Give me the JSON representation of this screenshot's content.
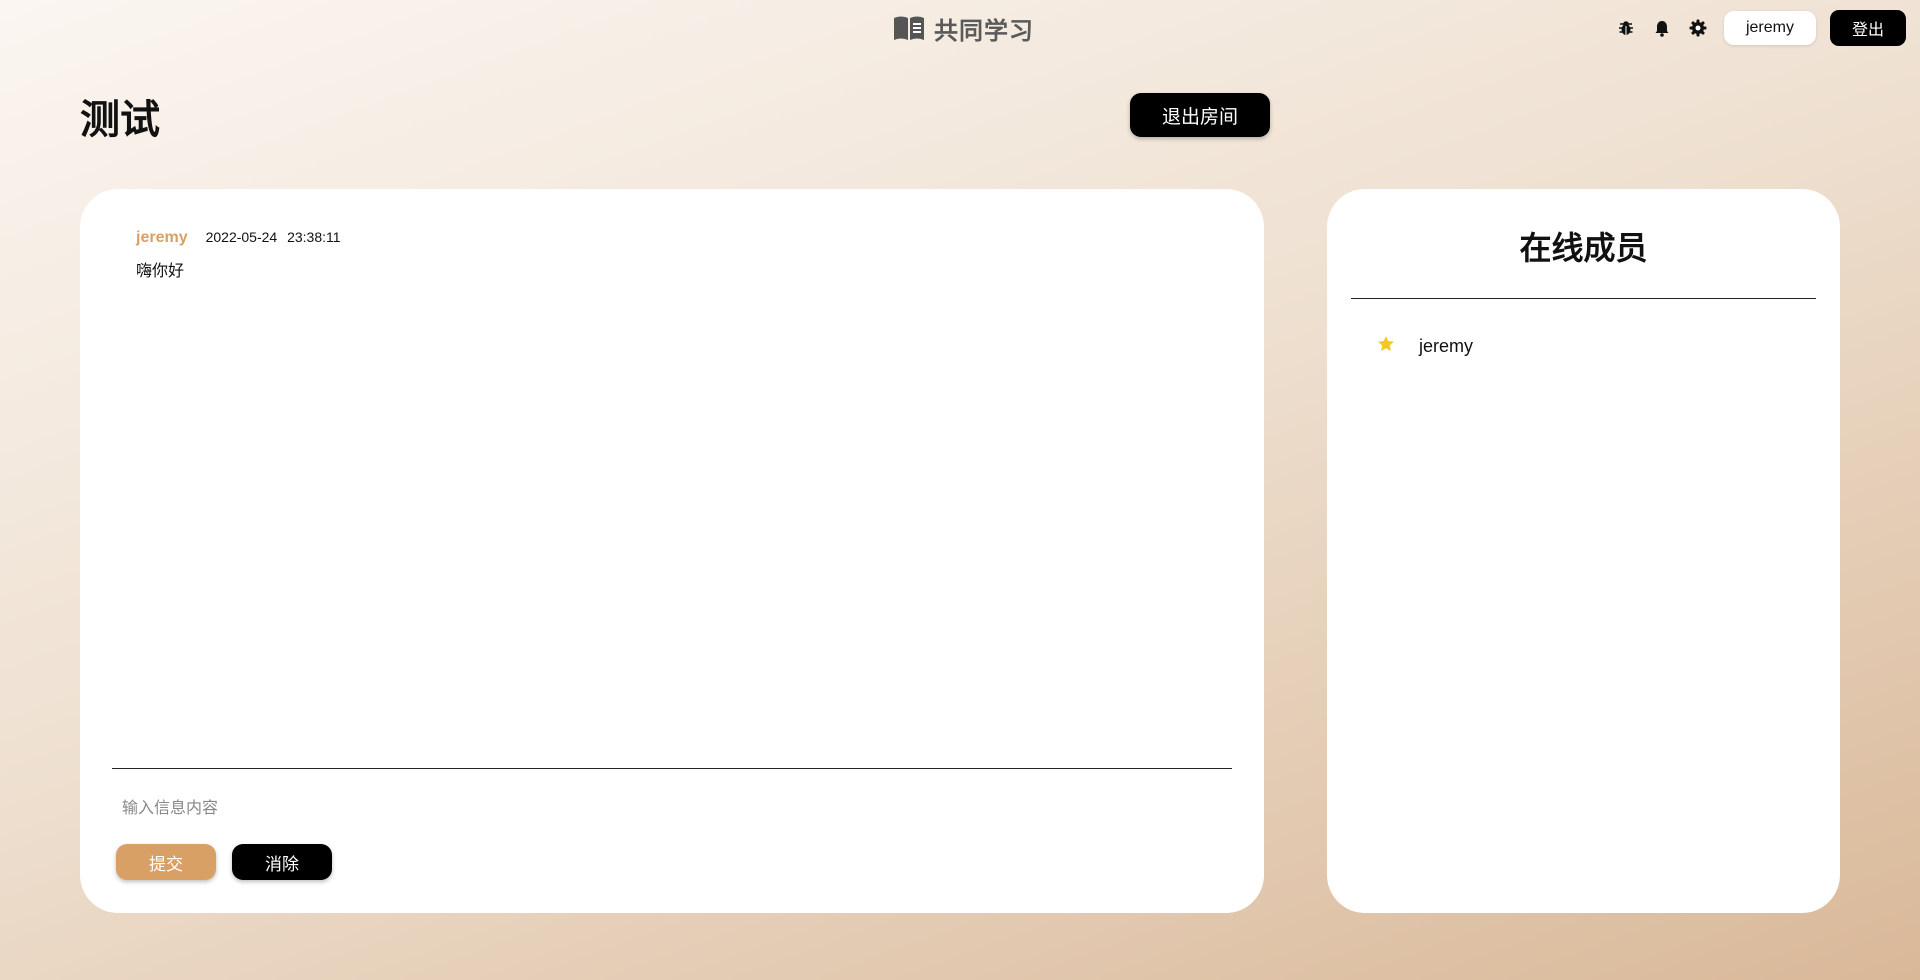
{
  "header": {
    "app_title": "共同学习",
    "app_icon": "book-icon",
    "icons": [
      "bug-icon",
      "bell-icon",
      "gear-icon"
    ],
    "user_name": "jeremy",
    "logout_label": "登出"
  },
  "room": {
    "title": "测试",
    "leave_label": "退出房间"
  },
  "chat": {
    "messages": [
      {
        "author": "jeremy",
        "timestamp": "2022-05-24 23:38:11",
        "text": "嗨你好"
      }
    ],
    "input": {
      "placeholder": "输入信息内容",
      "value": ""
    },
    "submit_label": "提交",
    "clear_label": "消除"
  },
  "members": {
    "title": "在线成员",
    "list": [
      {
        "name": "jeremy",
        "icon": "star-icon"
      }
    ]
  },
  "colors": {
    "accent": "#d9a066",
    "star": "#f2c824",
    "button_dark": "#000000",
    "panel": "#ffffff"
  }
}
